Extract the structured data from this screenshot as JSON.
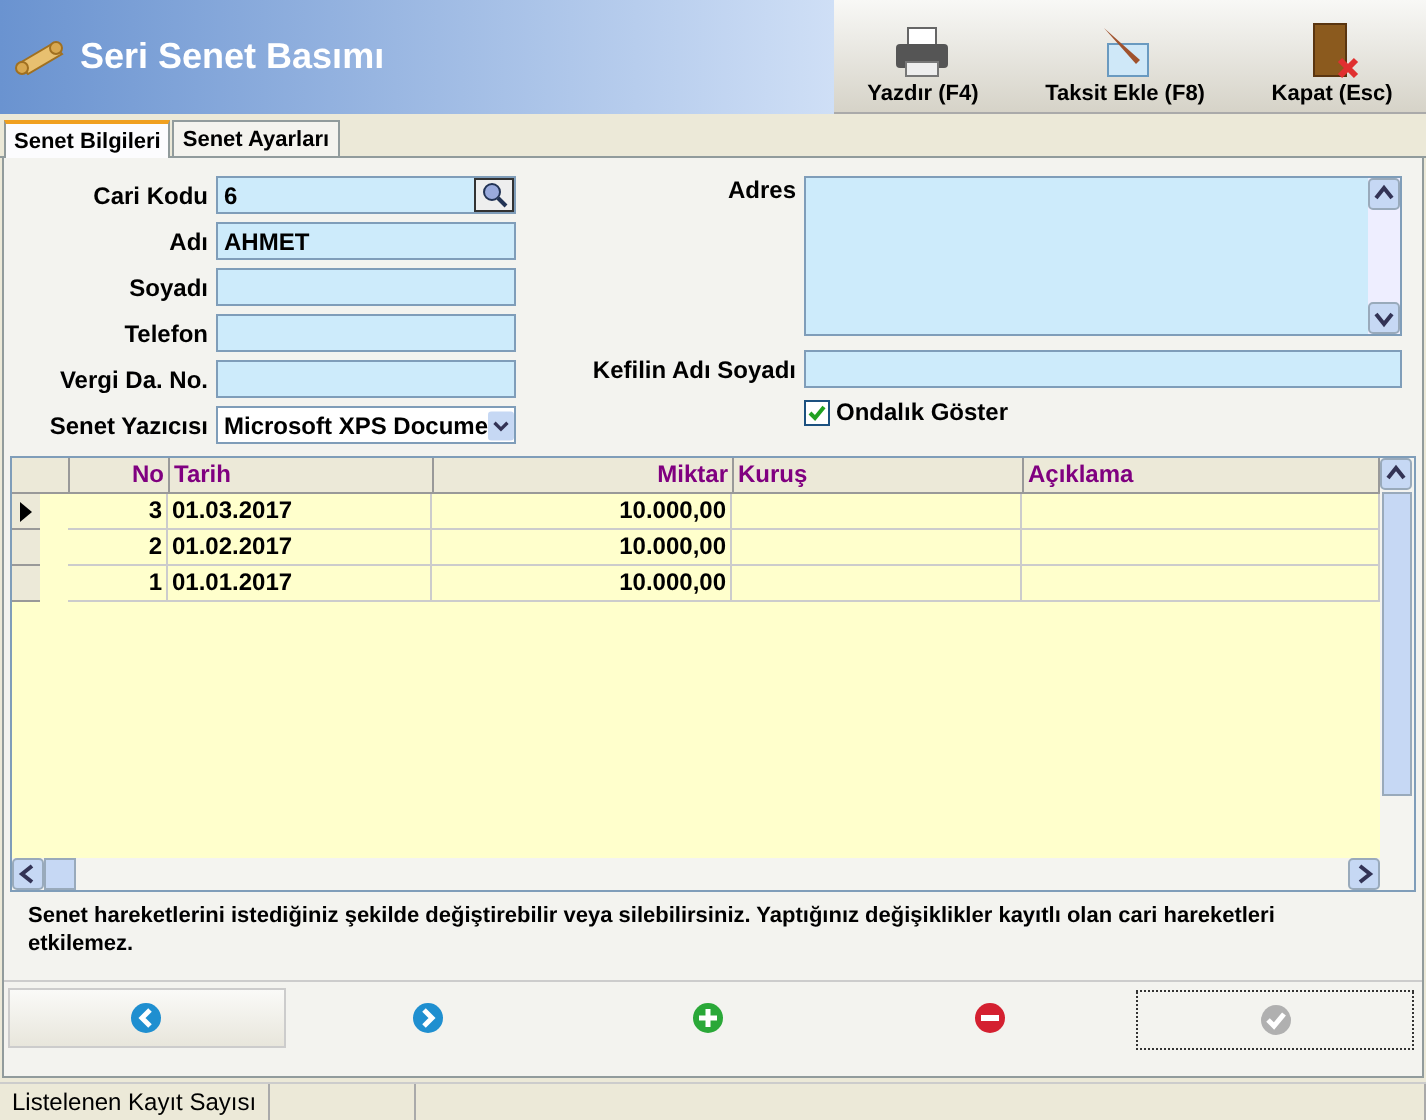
{
  "window": {
    "title": "Seri Senet Basımı"
  },
  "toolbar": [
    {
      "kind": "printer",
      "label": "Yazdır (F4)"
    },
    {
      "kind": "edit",
      "label": "Taksit Ekle (F8)"
    },
    {
      "kind": "exit",
      "label": "Kapat (Esc)"
    }
  ],
  "tabs": [
    {
      "label": "Senet Bilgileri",
      "selected": true
    },
    {
      "label": "Senet Ayarları",
      "selected": false
    }
  ],
  "form_left": [
    {
      "kind": "lookup",
      "label": "Cari Kodu",
      "value": "6"
    },
    {
      "kind": "text",
      "label": "Adı",
      "value": "AHMET"
    },
    {
      "kind": "text",
      "label": "Soyadı"
    },
    {
      "kind": "text",
      "label": "Telefon"
    },
    {
      "kind": "text",
      "label": "Vergi Da. No."
    },
    {
      "kind": "select",
      "label": "Senet Yazıcısı",
      "value": "Microsoft XPS Docume"
    }
  ],
  "address": {
    "label": "Adres"
  },
  "guarantor": {
    "label": "Kefilin Adı Soyadı"
  },
  "decimal_checkbox": {
    "label": "Ondalık Göster",
    "checked": true
  },
  "table": {
    "columns": [
      "No",
      "Tarih",
      "Miktar",
      "Kuruş",
      "Açıklama"
    ],
    "rows": [
      {
        "selected": true,
        "cells": [
          "3",
          "01.03.2017",
          "10.000,00"
        ]
      },
      {
        "selected": false,
        "cells": [
          "2",
          "01.02.2017",
          "10.000,00"
        ]
      },
      {
        "selected": false,
        "cells": [
          "1",
          "01.01.2017",
          "10.000,00"
        ]
      }
    ]
  },
  "note": "Senet hareketlerini istediğiniz şekilde değiştirebilir veya silebilirsiniz. Yaptığınız değişiklikler kayıtlı olan cari hareketleri etkilemez.",
  "nav_buttons": [
    {
      "kind": "prev",
      "disabled": false
    },
    {
      "kind": "next",
      "disabled": false
    },
    {
      "kind": "add",
      "disabled": false
    },
    {
      "kind": "delete",
      "disabled": false
    },
    {
      "kind": "confirm",
      "disabled": true
    }
  ],
  "status_bar": [
    "Listelenen Kayıt Sayısı"
  ]
}
